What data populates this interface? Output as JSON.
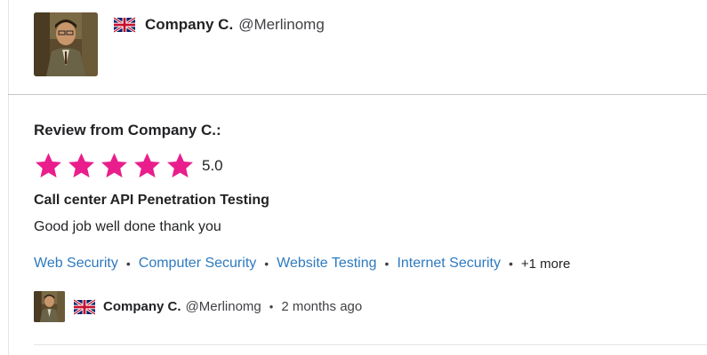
{
  "reviewer": {
    "name": "Company C.",
    "handle": "@Merlinomg",
    "country_flag_icon": "uk-flag-icon"
  },
  "review": {
    "heading": "Review from Company C.:",
    "rating": 5,
    "rating_label": "5.0",
    "star_color": "#e91e8c",
    "project_title": "Call center API Penetration Testing",
    "text": "Good job well done thank you",
    "tags": [
      "Web Security",
      "Computer Security",
      "Website Testing",
      "Internet Security"
    ],
    "more_tags": "+1 more",
    "tag_color": "#2e7abf"
  },
  "footer": {
    "name": "Company C.",
    "handle": "@Merlinomg",
    "time": "2 months ago"
  }
}
